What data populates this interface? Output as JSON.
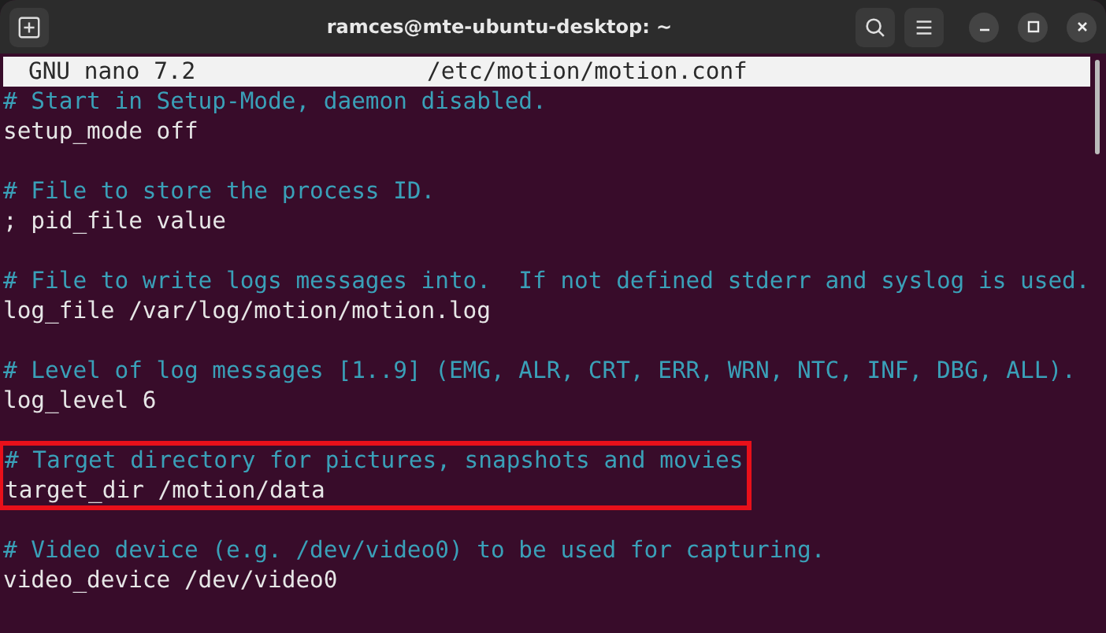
{
  "window": {
    "title": "ramces@mte-ubuntu-desktop: ~"
  },
  "nano_header": {
    "version": "GNU nano 7.2",
    "file": "/etc/motion/motion.conf"
  },
  "lines": [
    {
      "kind": "comment",
      "text": "# Start in Setup-Mode, daemon disabled.",
      "highlighted": false
    },
    {
      "kind": "setting",
      "text": "setup_mode off",
      "highlighted": false
    },
    {
      "kind": "blank"
    },
    {
      "kind": "comment",
      "text": "# File to store the process ID.",
      "highlighted": false
    },
    {
      "kind": "setting",
      "text": "; pid_file value",
      "highlighted": false
    },
    {
      "kind": "blank"
    },
    {
      "kind": "comment",
      "text": "# File to write logs messages into.  If not defined stderr and syslog is used.",
      "highlighted": false
    },
    {
      "kind": "setting",
      "text": "log_file /var/log/motion/motion.log",
      "highlighted": false
    },
    {
      "kind": "blank"
    },
    {
      "kind": "comment",
      "text": "# Level of log messages [1..9] (EMG, ALR, CRT, ERR, WRN, NTC, INF, DBG, ALL).",
      "highlighted": false
    },
    {
      "kind": "setting",
      "text": "log_level 6",
      "highlighted": false
    },
    {
      "kind": "blank"
    },
    {
      "kind": "comment",
      "text": "# Target directory for pictures, snapshots and movies",
      "highlighted": true
    },
    {
      "kind": "setting",
      "text": "target_dir /motion/data",
      "highlighted": true
    },
    {
      "kind": "blank"
    },
    {
      "kind": "comment",
      "text": "# Video device (e.g. /dev/video0) to be used for capturing.",
      "highlighted": false
    },
    {
      "kind": "setting",
      "text": "video_device /dev/video0",
      "highlighted": false
    }
  ]
}
